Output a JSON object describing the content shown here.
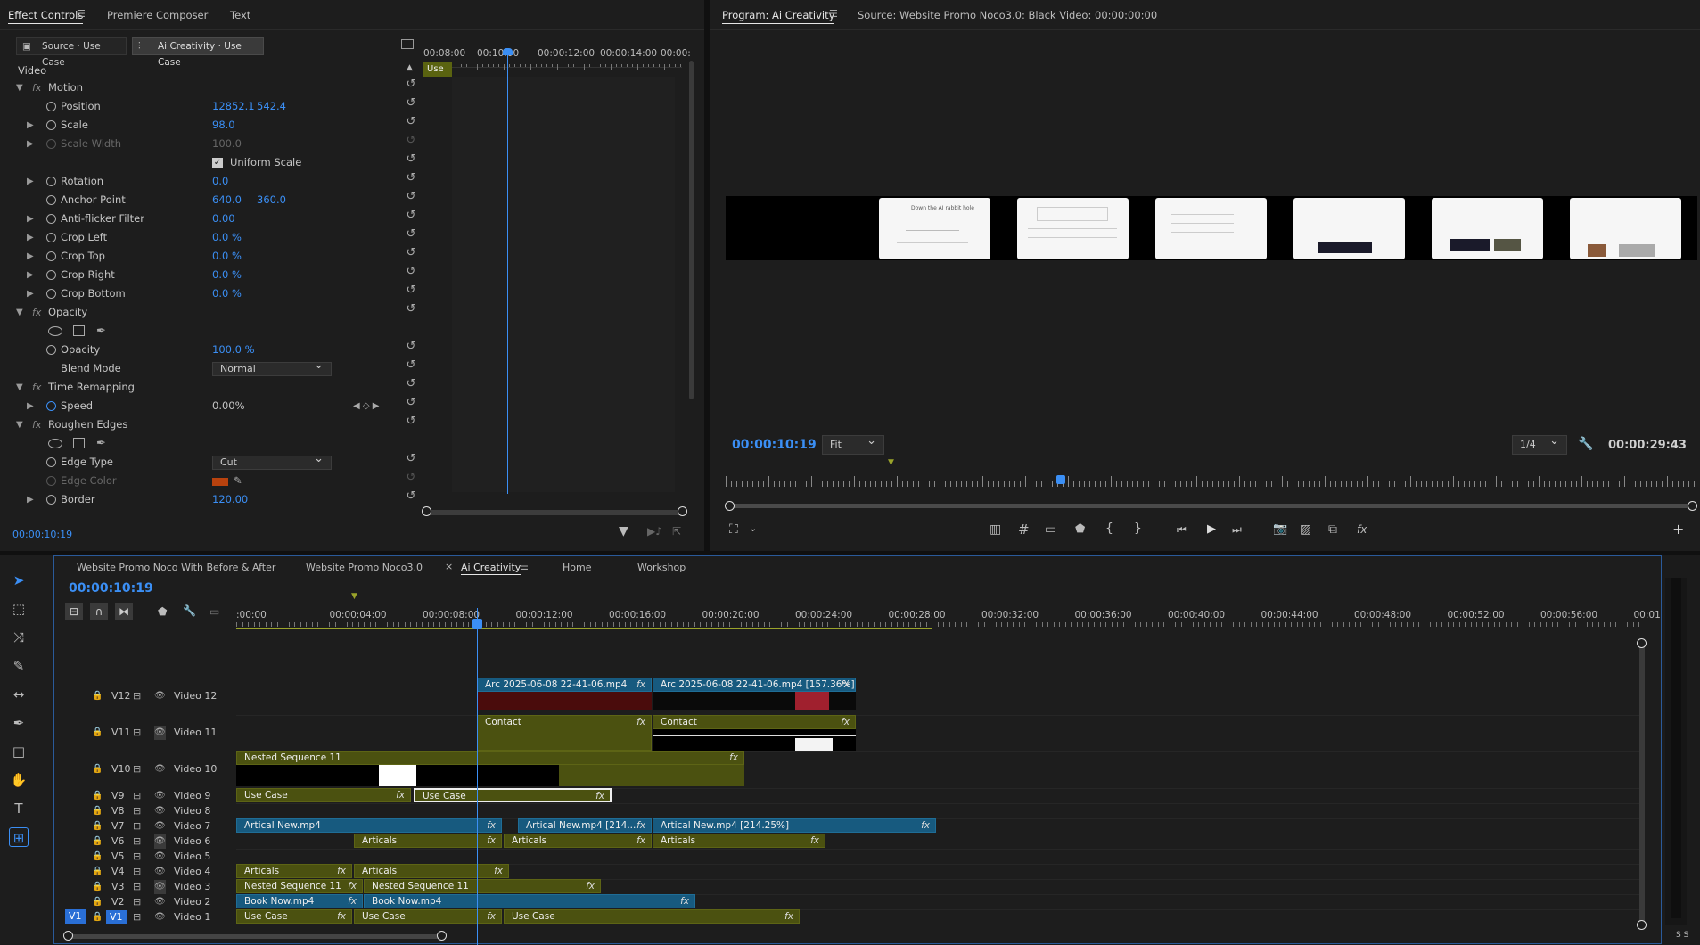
{
  "effect_controls": {
    "tabs": [
      "Effect Controls",
      "Premiere Composer",
      "Text"
    ],
    "source_btn": "Source · Use Case",
    "seq_btn": "Ai Creativity · Use Case",
    "section": "Video",
    "ruler": [
      "00:08:00",
      "00:10:00",
      "00:00:12:00",
      "00:00:14:00",
      "00:00:"
    ],
    "clip_label": "Use Ca",
    "rows": [
      {
        "label": "Motion",
        "type": "fx"
      },
      {
        "label": "Position",
        "v1": "12852.1",
        "v2": "542.4"
      },
      {
        "label": "Scale",
        "v1": "98.0"
      },
      {
        "label": "Scale Width",
        "v1": "100.0",
        "dim": true
      },
      {
        "label": "Uniform Scale",
        "type": "check"
      },
      {
        "label": "Rotation",
        "v1": "0.0"
      },
      {
        "label": "Anchor Point",
        "v1": "640.0",
        "v2": "360.0"
      },
      {
        "label": "Anti-flicker Filter",
        "v1": "0.00"
      },
      {
        "label": "Crop Left",
        "v1": "0.0 %"
      },
      {
        "label": "Crop Top",
        "v1": "0.0 %"
      },
      {
        "label": "Crop Right",
        "v1": "0.0 %"
      },
      {
        "label": "Crop Bottom",
        "v1": "0.0 %"
      },
      {
        "label": "Opacity",
        "type": "fx"
      },
      {
        "label": "",
        "type": "masks"
      },
      {
        "label": "Opacity",
        "v1": "100.0 %"
      },
      {
        "label": "Blend Mode",
        "type": "select",
        "v1": "Normal"
      },
      {
        "label": "Time Remapping",
        "type": "fx"
      },
      {
        "label": "Speed",
        "v1": "0.00%",
        "plain": true
      },
      {
        "label": "Roughen Edges",
        "type": "fx"
      },
      {
        "label": "",
        "type": "masks"
      },
      {
        "label": "Edge Type",
        "type": "select",
        "v1": "Cut"
      },
      {
        "label": "Edge Color",
        "type": "color",
        "dim": true
      },
      {
        "label": "Border",
        "v1": "120.00"
      }
    ],
    "timecode": "00:00:10:19",
    "edge_color": "#b8420e"
  },
  "program": {
    "tab": "Program: Ai Creativity",
    "source_tab": "Source: Website Promo Noco3.0: Black Video: 00:00:00:00",
    "timecode": "00:00:10:19",
    "fit": "Fit",
    "quality": "1/4",
    "duration": "00:00:29:43",
    "thumb_text": "Down the AI rabbit hole"
  },
  "timeline": {
    "tabs": [
      "Website Promo Noco With Before & After",
      "Website Promo Noco3.0",
      "Ai Creativity",
      "Home",
      "Workshop"
    ],
    "timecode": "00:00:10:19",
    "ruler": [
      ":00:00",
      "00:00:04:00",
      "00:00:08:00",
      "00:00:12:00",
      "00:00:16:00",
      "00:00:20:00",
      "00:00:24:00",
      "00:00:28:00",
      "00:00:32:00",
      "00:00:36:00",
      "00:00:40:00",
      "00:00:44:00",
      "00:00:48:00",
      "00:00:52:00",
      "00:00:56:00",
      "00:01"
    ],
    "tracks": [
      {
        "id": "V12",
        "name": "Video 12"
      },
      {
        "id": "V11",
        "name": "Video 11"
      },
      {
        "id": "V10",
        "name": "Video 10"
      },
      {
        "id": "V9",
        "name": "Video 9"
      },
      {
        "id": "V8",
        "name": "Video 8"
      },
      {
        "id": "V7",
        "name": "Video 7"
      },
      {
        "id": "V6",
        "name": "Video 6"
      },
      {
        "id": "V5",
        "name": "Video 5"
      },
      {
        "id": "V4",
        "name": "Video 4"
      },
      {
        "id": "V3",
        "name": "Video 3"
      },
      {
        "id": "V2",
        "name": "Video 2"
      },
      {
        "id": "V1",
        "name": "Video 1"
      }
    ],
    "clips": {
      "v12a": "Arc 2025-06-08 22-41-06.mp4",
      "v12b": "Arc 2025-06-08 22-41-06.mp4 [157.36%]",
      "v11a": "Contact",
      "v11b": "Contact",
      "v10": "Nested Sequence 11",
      "v9a": "Use Case",
      "v9b": "Use Case",
      "v7a": "Artical New.mp4",
      "v7b": "Artical New.mp4 [214...",
      "v7c": "Artical New.mp4 [214.25%]",
      "v6a": "Articals",
      "v6b": "Articals",
      "v6c": "Articals",
      "v4a": "Articals",
      "v4b": "Articals",
      "v3a": "Nested Sequence 11",
      "v3b": "Nested Sequence 11",
      "v2a": "Book Now.mp4",
      "v2b": "Book Now.mp4",
      "v1a": "Use Case",
      "v1b": "Use Case",
      "v1c": "Use Case"
    },
    "src_patch": "V1",
    "meter": "S S"
  }
}
